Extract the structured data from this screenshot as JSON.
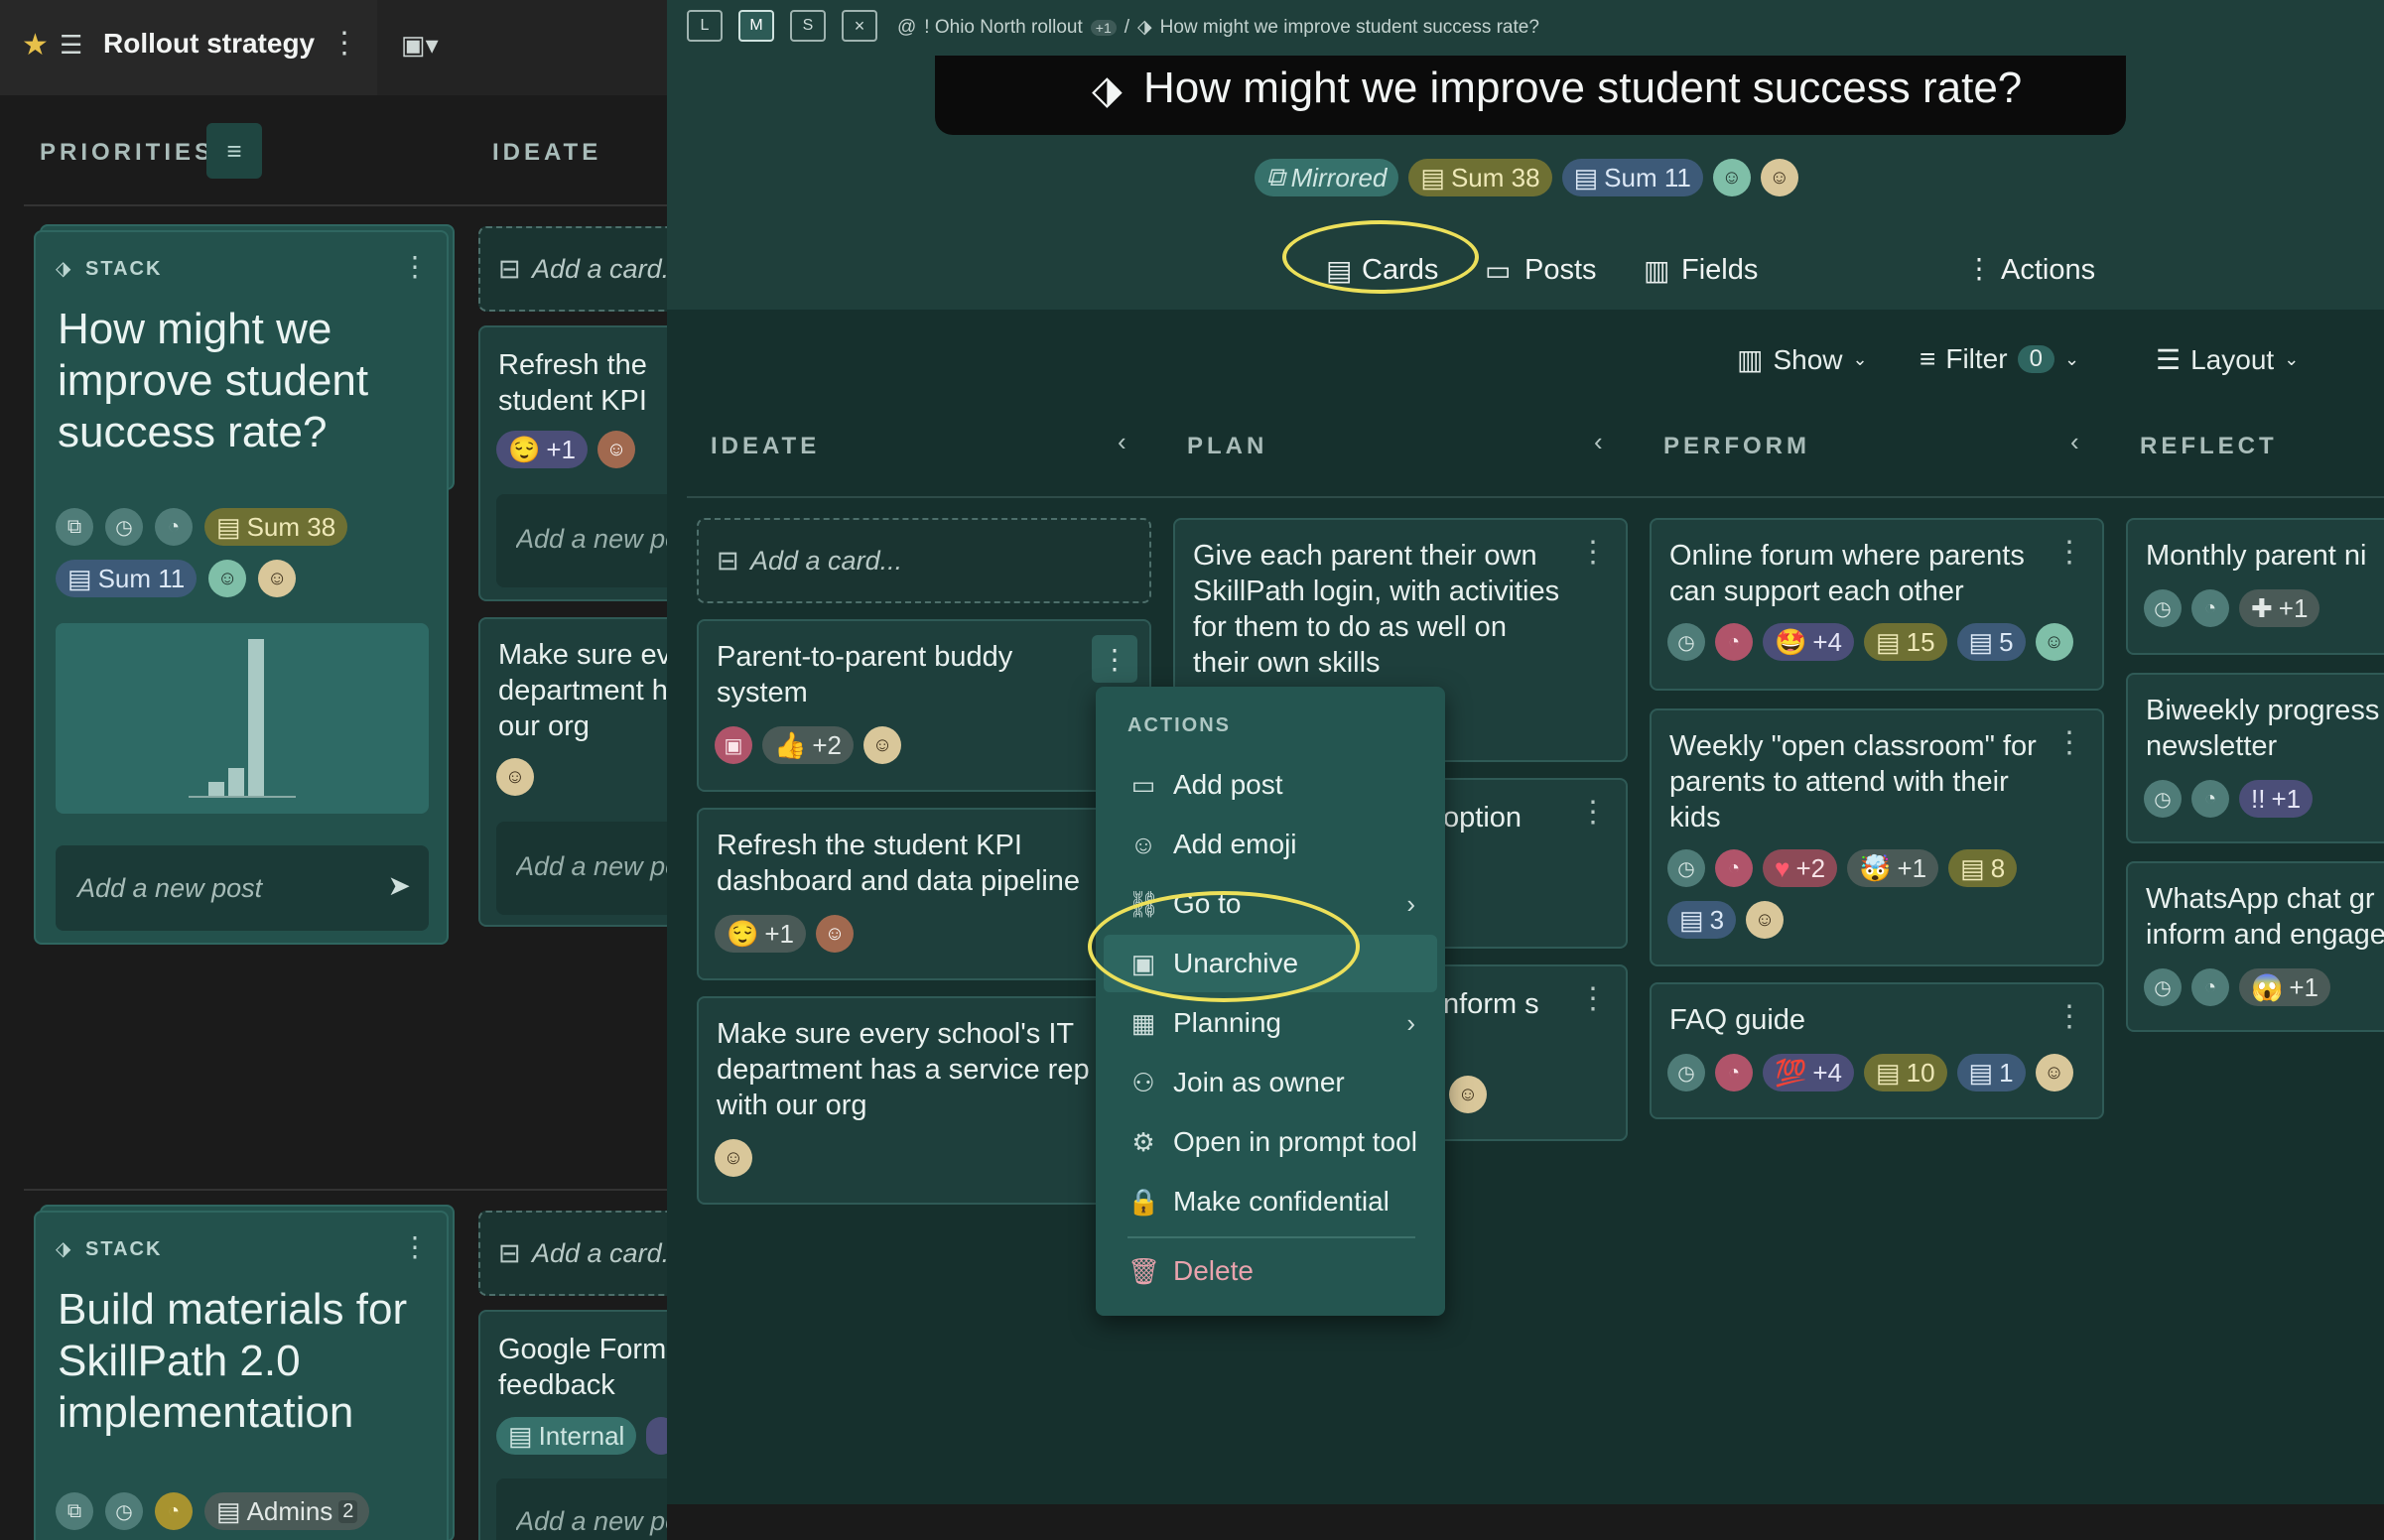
{
  "left": {
    "title": "Rollout strategy",
    "priorities_label": "PRIORITIES",
    "ideate_label": "IDEATE",
    "stack1": {
      "type_label": "STACK",
      "title": "How might we improve student success rate?",
      "sum38": "Sum 38",
      "sum11": "Sum 11",
      "add_post_placeholder": "Add a new post"
    },
    "col_cards": {
      "add_card": "Add a card...",
      "card1": "Refresh the student KPI dashboard and data pipeline",
      "card1_react": "+1",
      "add_post": "Add a new post",
      "card2": "Make sure every school's IT department has a service rep with our org",
      "add_post2": "Add a new post"
    },
    "stack2": {
      "type_label": "STACK",
      "title": "Build materials for SkillPath 2.0 implementation",
      "admins_label": "Admins",
      "admins_count": "2"
    },
    "col_cards2": {
      "add_card": "Add a card...",
      "card1": "Google Form feedback",
      "internal_label": "Internal",
      "add_post": "Add a new post"
    }
  },
  "right": {
    "view_buttons": [
      "L",
      "M",
      "S",
      "×"
    ],
    "breadcrumb": {
      "at": "@",
      "workspace": "! Ohio North rollout",
      "plus": "+1",
      "sep": "/",
      "current": "How might we improve student success rate?"
    },
    "title": "How might we improve student success rate?",
    "badges": {
      "mirrored": "Mirrored",
      "sum38": "Sum 38",
      "sum11": "Sum 11"
    },
    "tabs": {
      "cards": "Cards",
      "posts": "Posts",
      "fields": "Fields",
      "actions": "Actions"
    },
    "toolbar": {
      "show": "Show",
      "filter": "Filter",
      "filter_count": "0",
      "layout": "Layout"
    },
    "columns": {
      "ideate": {
        "label": "IDEATE",
        "add_card": "Add a card...",
        "cards": [
          {
            "text": "Parent-to-parent buddy system",
            "react": "+2"
          },
          {
            "text": "Refresh the student KPI dashboard and data pipeline",
            "react": "+1"
          },
          {
            "text": "Make sure every school's IT department has a service rep with our org"
          }
        ]
      },
      "plan": {
        "label": "PLAN",
        "cards": [
          {
            "text": "Give each parent their own SkillPath login, with activities for them to do as well on their own skills"
          },
          {
            "text": "option"
          },
          {
            "text": "nform s"
          }
        ]
      },
      "perform": {
        "label": "PERFORM",
        "cards": [
          {
            "text": "Online forum where parents can support each other",
            "react": "+4",
            "n1": "15",
            "n2": "5"
          },
          {
            "text": "Weekly \"open classroom\" for parents to attend with their kids",
            "react1": "+2",
            "react2": "+1",
            "n1": "8",
            "n2": "3"
          },
          {
            "text": "FAQ guide",
            "react": "+4",
            "n1": "10",
            "n2": "1"
          }
        ]
      },
      "reflect": {
        "label": "REFLECT",
        "cards": [
          {
            "text": "Monthly parent ni",
            "react": "+1"
          },
          {
            "text": "Biweekly progress newsletter",
            "react": "+1",
            "emoji": "!!"
          },
          {
            "text": "WhatsApp chat gr inform and engage",
            "react": "+1"
          }
        ]
      }
    },
    "menu": {
      "header": "ACTIONS",
      "items": [
        "Add post",
        "Add emoji",
        "Go to",
        "Unarchive",
        "Planning",
        "Join as owner",
        "Open in prompt tool",
        "Make confidential",
        "Delete"
      ]
    }
  }
}
